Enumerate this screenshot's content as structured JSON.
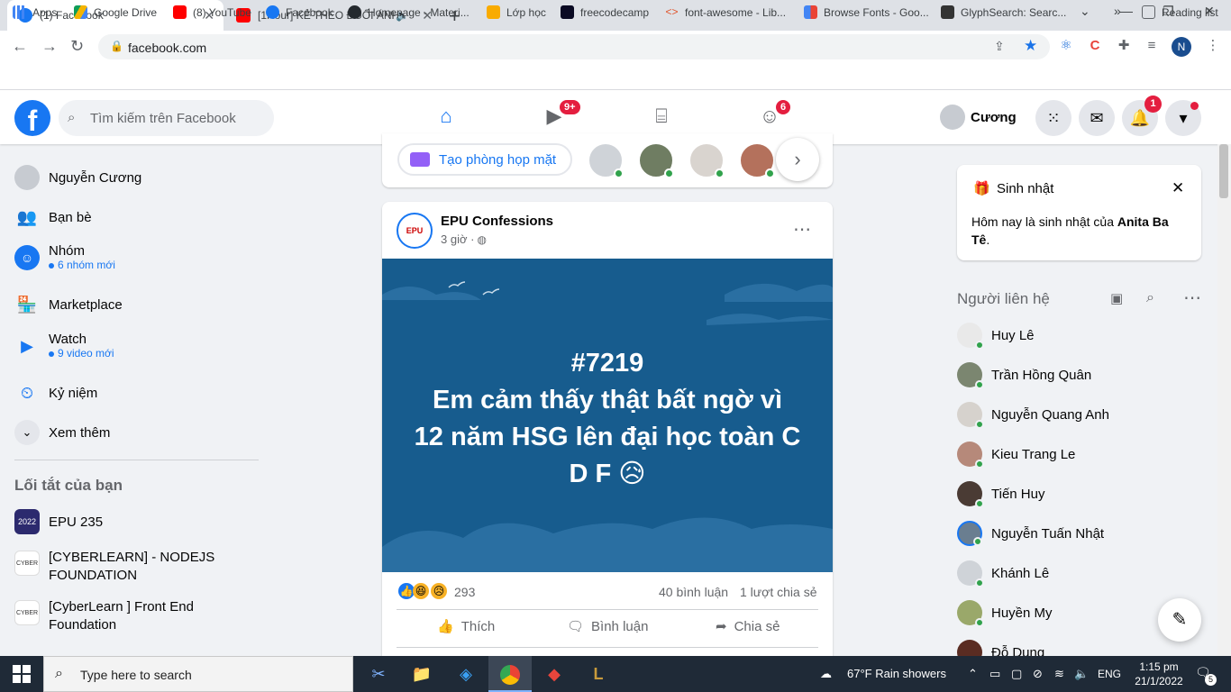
{
  "browser": {
    "tabs": [
      {
        "title": "(1) Facebook",
        "active": true
      },
      {
        "title": "[1Hour] KẺ THEO ĐUỔI ÁNH",
        "active": false
      }
    ],
    "url": "facebook.com",
    "profile_initial": "N",
    "bookmarks": [
      "Apps",
      "Google Drive",
      "(8) YouTube",
      "Facebook",
      "Homepage - Materi...",
      "Lớp học",
      "freecodecamp",
      "font-awesome - Lib...",
      "Browse Fonts - Goo...",
      "GlyphSearch: Searc..."
    ],
    "bookmarks_overflow": "»",
    "reading_list": "Reading list"
  },
  "header": {
    "logo": "f",
    "search_placeholder": "Tìm kiếm trên Facebook",
    "watch_badge": "9+",
    "groups_badge": "6",
    "user_name": "Cương",
    "notif_badge": "1"
  },
  "left": {
    "items": [
      {
        "label": "Nguyễn Cương"
      },
      {
        "label": "Bạn bè"
      },
      {
        "label": "Nhóm",
        "sub": "6 nhóm mới"
      },
      {
        "label": "Marketplace"
      },
      {
        "label": "Watch",
        "sub": "9 video mới"
      },
      {
        "label": "Kỷ niệm"
      },
      {
        "label": "Xem thêm"
      }
    ],
    "shortcuts_title": "Lối tắt của bạn",
    "shortcuts": [
      {
        "label": "EPU 235",
        "icon_text": "2022"
      },
      {
        "label": "[CYBERLEARN] - NODEJS FOUNDATION",
        "icon_text": "CYBER"
      },
      {
        "label": "[CyberLearn ] Front End Foundation",
        "icon_text": "CYBER"
      }
    ]
  },
  "feed": {
    "room_button": "Tạo phòng họp mặt",
    "post": {
      "author": "EPU Confessions",
      "avatar_text": "EPU",
      "time": "3 giờ ·",
      "text": "#7219\nEm cảm thấy thật bất ngờ vì\n12 năm HSG lên đại học toàn C\nD F 😥",
      "reaction_count": "293",
      "comments": "40 bình luận",
      "shares": "1 lượt chia sẻ",
      "actions": [
        "Thích",
        "Bình luận",
        "Chia sẻ"
      ]
    }
  },
  "right": {
    "birthday_title": "Sinh nhật",
    "birthday_text_prefix": "Hôm nay là sinh nhật của",
    "birthday_name": "Anita Ba Tê",
    "birthday_text_suffix": ".",
    "contacts_title": "Người liên hệ",
    "contacts": [
      "Huy Lê",
      "Trần Hồng Quân",
      "Nguyễn Quang Anh",
      "Kieu Trang Le",
      "Tiến Huy",
      "Nguyễn Tuấn Nhật",
      "Khánh Lê",
      "Huyền My",
      "Đỗ Dung"
    ]
  },
  "taskbar": {
    "search_placeholder": "Type here to search",
    "weather": "67°F  Rain showers",
    "lang": "ENG",
    "time": "1:15 pm",
    "date": "21/1/2022",
    "notif_count": "5"
  },
  "colors": {
    "facebook_blue": "#1877f2",
    "notification_red": "#e41e3f",
    "post_bg": "#175c8e",
    "online_green": "#31a24c"
  }
}
